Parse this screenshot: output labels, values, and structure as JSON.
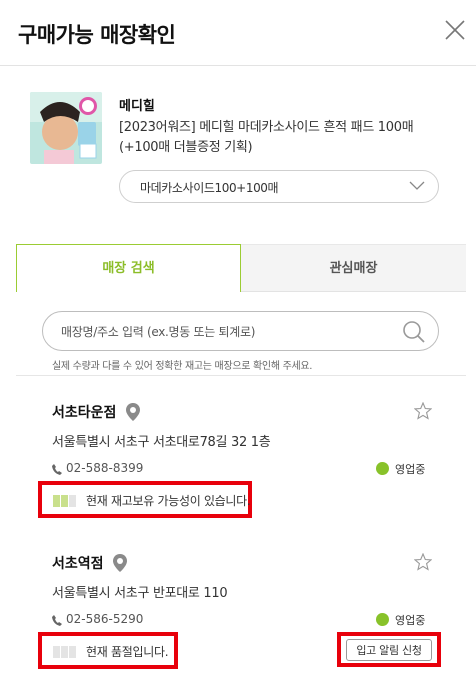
{
  "header": {
    "title": "구매가능 매장확인"
  },
  "product": {
    "brand": "메디힐",
    "name": "[2023어워즈] 메디힐 마데카소사이드 흔적 패드 100매 (+100매 더블증정 기획)",
    "option": "마데카소사이드100+100매"
  },
  "tabs": [
    {
      "label": "매장 검색"
    },
    {
      "label": "관심매장"
    }
  ],
  "search": {
    "placeholder": "매장명/주소 입력 (ex.명동 또는 퇴계로)",
    "notice": "실제 수량과 다를 수 있어 정확한 재고는 매장으로 확인해 주세요."
  },
  "stores": [
    {
      "name": "서초타운점",
      "address": "서울특별시 서초구 서초대로78길 32 1층",
      "phone": "02-588-8399",
      "status": "영업중",
      "stock_text": "현재 재고보유 가능성이 있습니다.",
      "stock_level": 2
    },
    {
      "name": "서초역점",
      "address": "서울특별시 서초구 반포대로 110",
      "phone": "02-586-5290",
      "status": "영업중",
      "stock_text": "현재 품절입니다.",
      "stock_level": 0,
      "notify_label": "입고 알림 신청"
    }
  ],
  "colors": {
    "accent_green": "#8cbd28",
    "status_open": "#88c22a",
    "highlight_red": "#e8000b"
  }
}
